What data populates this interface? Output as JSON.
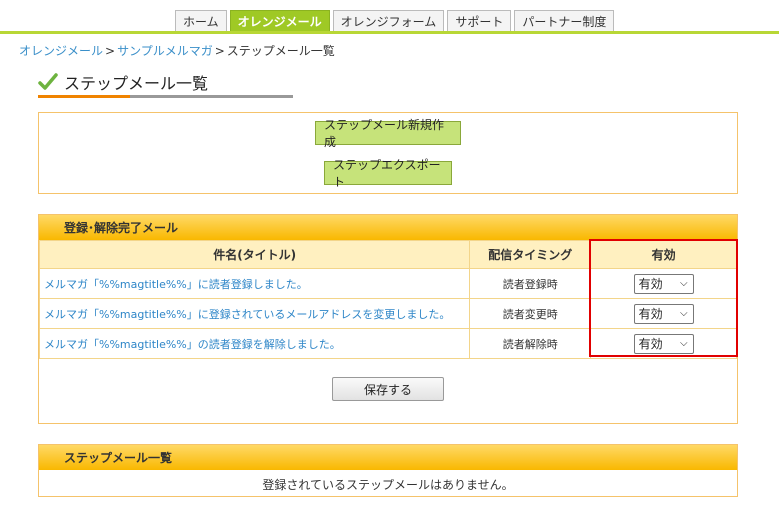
{
  "nav": {
    "tabs": [
      {
        "label": "ホーム",
        "active": false
      },
      {
        "label": "オレンジメール",
        "active": true
      },
      {
        "label": "オレンジフォーム",
        "active": false
      },
      {
        "label": "サポート",
        "active": false
      },
      {
        "label": "パートナー制度",
        "active": false
      }
    ]
  },
  "breadcrumb": {
    "items": [
      "オレンジメール",
      "サンプルメルマガ"
    ],
    "current": "ステップメール一覧",
    "separator": ">"
  },
  "page": {
    "title": "ステップメール一覧",
    "title_icon": "check-icon"
  },
  "actions": {
    "new_button": "ステップメール新規作成",
    "export_button": "ステップエクスポート"
  },
  "completion_section": {
    "header": "登録･解除完了メール",
    "columns": [
      "件名(タイトル)",
      "配信タイミング",
      "有効"
    ],
    "rows": [
      {
        "name": "メルマガ「%%magtitle%%」に読者登録しました。",
        "timing": "読者登録時",
        "enabled": "有効"
      },
      {
        "name": "メルマガ「%%magtitle%%」に登録されているメールアドレスを変更しました。",
        "timing": "読者変更時",
        "enabled": "有効"
      },
      {
        "name": "メルマガ「%%magtitle%%」の読者登録を解除しました。",
        "timing": "読者解除時",
        "enabled": "有効"
      }
    ],
    "save_button": "保存する"
  },
  "step_section": {
    "header": "ステップメール一覧",
    "empty_message": "登録されているステップメールはありません。"
  },
  "colors": {
    "accent_green": "#9fc925",
    "header_orange": "#f9b800",
    "link_blue": "#2e86c8",
    "highlight_red": "#e10000"
  }
}
